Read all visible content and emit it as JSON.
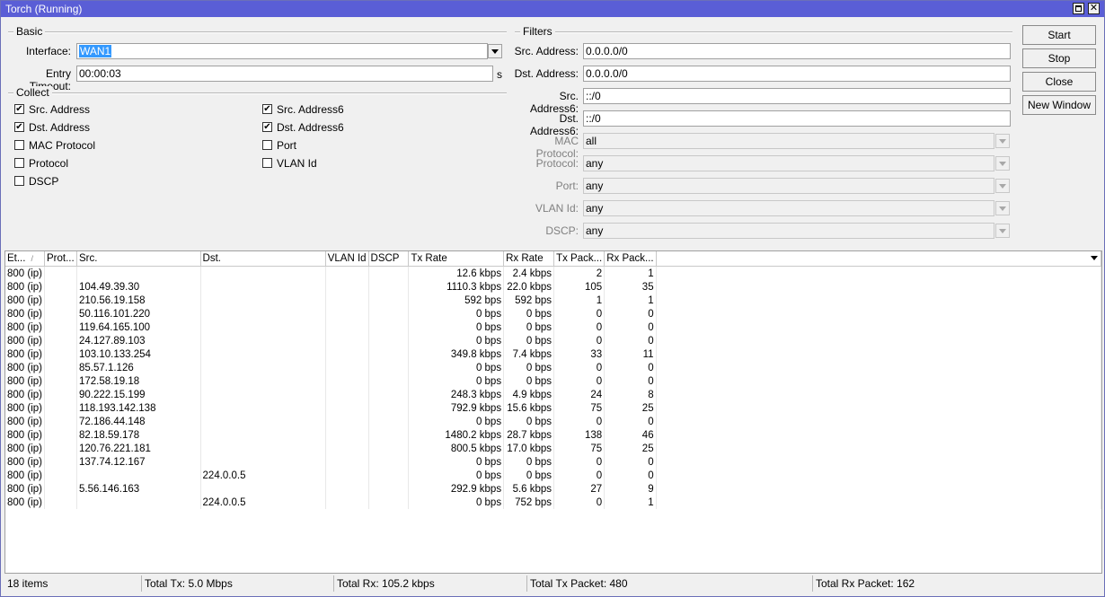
{
  "window": {
    "title": "Torch (Running)"
  },
  "basic": {
    "label": "Basic",
    "interface_label": "Interface:",
    "interface_value": "WAN1",
    "entry_timeout_label": "Entry Timeout:",
    "entry_timeout_value": "00:00:03",
    "entry_timeout_unit": "s"
  },
  "collect": {
    "label": "Collect",
    "items": [
      {
        "label": "Src. Address",
        "checked": true
      },
      {
        "label": "Dst. Address",
        "checked": true
      },
      {
        "label": "MAC Protocol",
        "checked": false
      },
      {
        "label": "Protocol",
        "checked": false
      },
      {
        "label": "DSCP",
        "checked": false
      },
      {
        "label": "Src. Address6",
        "checked": true
      },
      {
        "label": "Dst. Address6",
        "checked": true
      },
      {
        "label": "Port",
        "checked": false
      },
      {
        "label": "VLAN Id",
        "checked": false
      }
    ]
  },
  "filters": {
    "label": "Filters",
    "src_address_label": "Src. Address:",
    "src_address_value": "0.0.0.0/0",
    "dst_address_label": "Dst. Address:",
    "dst_address_value": "0.0.0.0/0",
    "src_address6_label": "Src. Address6:",
    "src_address6_value": "::/0",
    "dst_address6_label": "Dst. Address6:",
    "dst_address6_value": "::/0",
    "mac_protocol_label": "MAC Protocol:",
    "mac_protocol_value": "all",
    "protocol_label": "Protocol:",
    "protocol_value": "any",
    "port_label": "Port:",
    "port_value": "any",
    "vlan_label": "VLAN Id:",
    "vlan_value": "any",
    "dscp_label": "DSCP:",
    "dscp_value": "any"
  },
  "buttons": {
    "start": "Start",
    "stop": "Stop",
    "close": "Close",
    "new_window": "New Window"
  },
  "table": {
    "columns": [
      "Et...",
      "Prot...",
      "Src.",
      "Dst.",
      "VLAN Id",
      "DSCP",
      "Tx Rate",
      "Rx Rate",
      "Tx Pack...",
      "Rx Pack..."
    ],
    "rows": [
      [
        "800 (ip)",
        "",
        "",
        "",
        "",
        "",
        "12.6 kbps",
        "2.4 kbps",
        "2",
        "1"
      ],
      [
        "800 (ip)",
        "",
        "104.49.39.30",
        "",
        "",
        "",
        "1110.3 kbps",
        "22.0 kbps",
        "105",
        "35"
      ],
      [
        "800 (ip)",
        "",
        "210.56.19.158",
        "",
        "",
        "",
        "592 bps",
        "592 bps",
        "1",
        "1"
      ],
      [
        "800 (ip)",
        "",
        "50.116.101.220",
        "",
        "",
        "",
        "0 bps",
        "0 bps",
        "0",
        "0"
      ],
      [
        "800 (ip)",
        "",
        "119.64.165.100",
        "",
        "",
        "",
        "0 bps",
        "0 bps",
        "0",
        "0"
      ],
      [
        "800 (ip)",
        "",
        "24.127.89.103",
        "",
        "",
        "",
        "0 bps",
        "0 bps",
        "0",
        "0"
      ],
      [
        "800 (ip)",
        "",
        "103.10.133.254",
        "",
        "",
        "",
        "349.8 kbps",
        "7.4 kbps",
        "33",
        "11"
      ],
      [
        "800 (ip)",
        "",
        "85.57.1.126",
        "",
        "",
        "",
        "0 bps",
        "0 bps",
        "0",
        "0"
      ],
      [
        "800 (ip)",
        "",
        "172.58.19.18",
        "",
        "",
        "",
        "0 bps",
        "0 bps",
        "0",
        "0"
      ],
      [
        "800 (ip)",
        "",
        "90.222.15.199",
        "",
        "",
        "",
        "248.3 kbps",
        "4.9 kbps",
        "24",
        "8"
      ],
      [
        "800 (ip)",
        "",
        "118.193.142.138",
        "",
        "",
        "",
        "792.9 kbps",
        "15.6 kbps",
        "75",
        "25"
      ],
      [
        "800 (ip)",
        "",
        "72.186.44.148",
        "",
        "",
        "",
        "0 bps",
        "0 bps",
        "0",
        "0"
      ],
      [
        "800 (ip)",
        "",
        "82.18.59.178",
        "",
        "",
        "",
        "1480.2 kbps",
        "28.7 kbps",
        "138",
        "46"
      ],
      [
        "800 (ip)",
        "",
        "120.76.221.181",
        "",
        "",
        "",
        "800.5 kbps",
        "17.0 kbps",
        "75",
        "25"
      ],
      [
        "800 (ip)",
        "",
        "137.74.12.167",
        "",
        "",
        "",
        "0 bps",
        "0 bps",
        "0",
        "0"
      ],
      [
        "800 (ip)",
        "",
        "",
        "224.0.0.5",
        "",
        "",
        "0 bps",
        "0 bps",
        "0",
        "0"
      ],
      [
        "800 (ip)",
        "",
        "5.56.146.163",
        "",
        "",
        "",
        "292.9 kbps",
        "5.6 kbps",
        "27",
        "9"
      ],
      [
        "800 (ip)",
        "",
        "",
        "224.0.0.5",
        "",
        "",
        "0 bps",
        "752 bps",
        "0",
        "1"
      ]
    ]
  },
  "status": {
    "items": "18 items",
    "total_tx": "Total Tx: 5.0 Mbps",
    "total_rx": "Total Rx: 105.2 kbps",
    "total_tx_packet": "Total Tx Packet: 480",
    "total_rx_packet": "Total Rx Packet: 162"
  }
}
